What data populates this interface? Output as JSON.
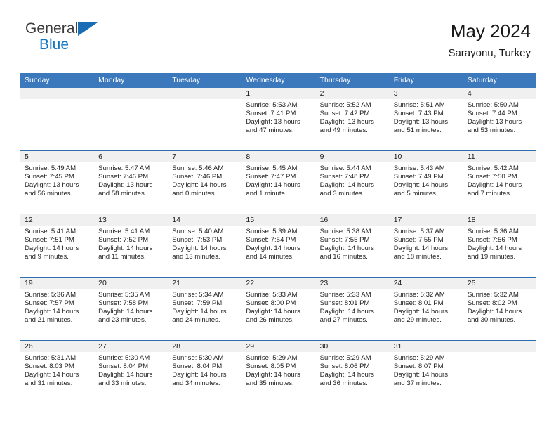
{
  "brand": {
    "name_top": "General",
    "name_bottom": "Blue",
    "triangle_icon": "brand-triangle-icon",
    "color_top": "#3b3b3b",
    "color_bottom": "#1076c4"
  },
  "header": {
    "title": "May 2024",
    "subtitle": "Sarayonu, Turkey"
  },
  "theme": {
    "header_blue": "#3c78bc",
    "row_divider_blue": "#2f6fb0",
    "daynum_band": "#f0f0f0",
    "text": "#222222"
  },
  "calendar": {
    "weekdays": [
      "Sunday",
      "Monday",
      "Tuesday",
      "Wednesday",
      "Thursday",
      "Friday",
      "Saturday"
    ],
    "weeks": [
      [
        {
          "day": "",
          "empty": true
        },
        {
          "day": "",
          "empty": true
        },
        {
          "day": "",
          "empty": true
        },
        {
          "day": "1",
          "sunrise": "Sunrise: 5:53 AM",
          "sunset": "Sunset: 7:41 PM",
          "daylight": "Daylight: 13 hours and 47 minutes."
        },
        {
          "day": "2",
          "sunrise": "Sunrise: 5:52 AM",
          "sunset": "Sunset: 7:42 PM",
          "daylight": "Daylight: 13 hours and 49 minutes."
        },
        {
          "day": "3",
          "sunrise": "Sunrise: 5:51 AM",
          "sunset": "Sunset: 7:43 PM",
          "daylight": "Daylight: 13 hours and 51 minutes."
        },
        {
          "day": "4",
          "sunrise": "Sunrise: 5:50 AM",
          "sunset": "Sunset: 7:44 PM",
          "daylight": "Daylight: 13 hours and 53 minutes."
        }
      ],
      [
        {
          "day": "5",
          "sunrise": "Sunrise: 5:49 AM",
          "sunset": "Sunset: 7:45 PM",
          "daylight": "Daylight: 13 hours and 56 minutes."
        },
        {
          "day": "6",
          "sunrise": "Sunrise: 5:47 AM",
          "sunset": "Sunset: 7:46 PM",
          "daylight": "Daylight: 13 hours and 58 minutes."
        },
        {
          "day": "7",
          "sunrise": "Sunrise: 5:46 AM",
          "sunset": "Sunset: 7:46 PM",
          "daylight": "Daylight: 14 hours and 0 minutes."
        },
        {
          "day": "8",
          "sunrise": "Sunrise: 5:45 AM",
          "sunset": "Sunset: 7:47 PM",
          "daylight": "Daylight: 14 hours and 1 minute."
        },
        {
          "day": "9",
          "sunrise": "Sunrise: 5:44 AM",
          "sunset": "Sunset: 7:48 PM",
          "daylight": "Daylight: 14 hours and 3 minutes."
        },
        {
          "day": "10",
          "sunrise": "Sunrise: 5:43 AM",
          "sunset": "Sunset: 7:49 PM",
          "daylight": "Daylight: 14 hours and 5 minutes."
        },
        {
          "day": "11",
          "sunrise": "Sunrise: 5:42 AM",
          "sunset": "Sunset: 7:50 PM",
          "daylight": "Daylight: 14 hours and 7 minutes."
        }
      ],
      [
        {
          "day": "12",
          "sunrise": "Sunrise: 5:41 AM",
          "sunset": "Sunset: 7:51 PM",
          "daylight": "Daylight: 14 hours and 9 minutes."
        },
        {
          "day": "13",
          "sunrise": "Sunrise: 5:41 AM",
          "sunset": "Sunset: 7:52 PM",
          "daylight": "Daylight: 14 hours and 11 minutes."
        },
        {
          "day": "14",
          "sunrise": "Sunrise: 5:40 AM",
          "sunset": "Sunset: 7:53 PM",
          "daylight": "Daylight: 14 hours and 13 minutes."
        },
        {
          "day": "15",
          "sunrise": "Sunrise: 5:39 AM",
          "sunset": "Sunset: 7:54 PM",
          "daylight": "Daylight: 14 hours and 14 minutes."
        },
        {
          "day": "16",
          "sunrise": "Sunrise: 5:38 AM",
          "sunset": "Sunset: 7:55 PM",
          "daylight": "Daylight: 14 hours and 16 minutes."
        },
        {
          "day": "17",
          "sunrise": "Sunrise: 5:37 AM",
          "sunset": "Sunset: 7:55 PM",
          "daylight": "Daylight: 14 hours and 18 minutes."
        },
        {
          "day": "18",
          "sunrise": "Sunrise: 5:36 AM",
          "sunset": "Sunset: 7:56 PM",
          "daylight": "Daylight: 14 hours and 19 minutes."
        }
      ],
      [
        {
          "day": "19",
          "sunrise": "Sunrise: 5:36 AM",
          "sunset": "Sunset: 7:57 PM",
          "daylight": "Daylight: 14 hours and 21 minutes."
        },
        {
          "day": "20",
          "sunrise": "Sunrise: 5:35 AM",
          "sunset": "Sunset: 7:58 PM",
          "daylight": "Daylight: 14 hours and 23 minutes."
        },
        {
          "day": "21",
          "sunrise": "Sunrise: 5:34 AM",
          "sunset": "Sunset: 7:59 PM",
          "daylight": "Daylight: 14 hours and 24 minutes."
        },
        {
          "day": "22",
          "sunrise": "Sunrise: 5:33 AM",
          "sunset": "Sunset: 8:00 PM",
          "daylight": "Daylight: 14 hours and 26 minutes."
        },
        {
          "day": "23",
          "sunrise": "Sunrise: 5:33 AM",
          "sunset": "Sunset: 8:01 PM",
          "daylight": "Daylight: 14 hours and 27 minutes."
        },
        {
          "day": "24",
          "sunrise": "Sunrise: 5:32 AM",
          "sunset": "Sunset: 8:01 PM",
          "daylight": "Daylight: 14 hours and 29 minutes."
        },
        {
          "day": "25",
          "sunrise": "Sunrise: 5:32 AM",
          "sunset": "Sunset: 8:02 PM",
          "daylight": "Daylight: 14 hours and 30 minutes."
        }
      ],
      [
        {
          "day": "26",
          "sunrise": "Sunrise: 5:31 AM",
          "sunset": "Sunset: 8:03 PM",
          "daylight": "Daylight: 14 hours and 31 minutes."
        },
        {
          "day": "27",
          "sunrise": "Sunrise: 5:30 AM",
          "sunset": "Sunset: 8:04 PM",
          "daylight": "Daylight: 14 hours and 33 minutes."
        },
        {
          "day": "28",
          "sunrise": "Sunrise: 5:30 AM",
          "sunset": "Sunset: 8:04 PM",
          "daylight": "Daylight: 14 hours and 34 minutes."
        },
        {
          "day": "29",
          "sunrise": "Sunrise: 5:29 AM",
          "sunset": "Sunset: 8:05 PM",
          "daylight": "Daylight: 14 hours and 35 minutes."
        },
        {
          "day": "30",
          "sunrise": "Sunrise: 5:29 AM",
          "sunset": "Sunset: 8:06 PM",
          "daylight": "Daylight: 14 hours and 36 minutes."
        },
        {
          "day": "31",
          "sunrise": "Sunrise: 5:29 AM",
          "sunset": "Sunset: 8:07 PM",
          "daylight": "Daylight: 14 hours and 37 minutes."
        },
        {
          "day": "",
          "empty": true
        }
      ]
    ]
  }
}
